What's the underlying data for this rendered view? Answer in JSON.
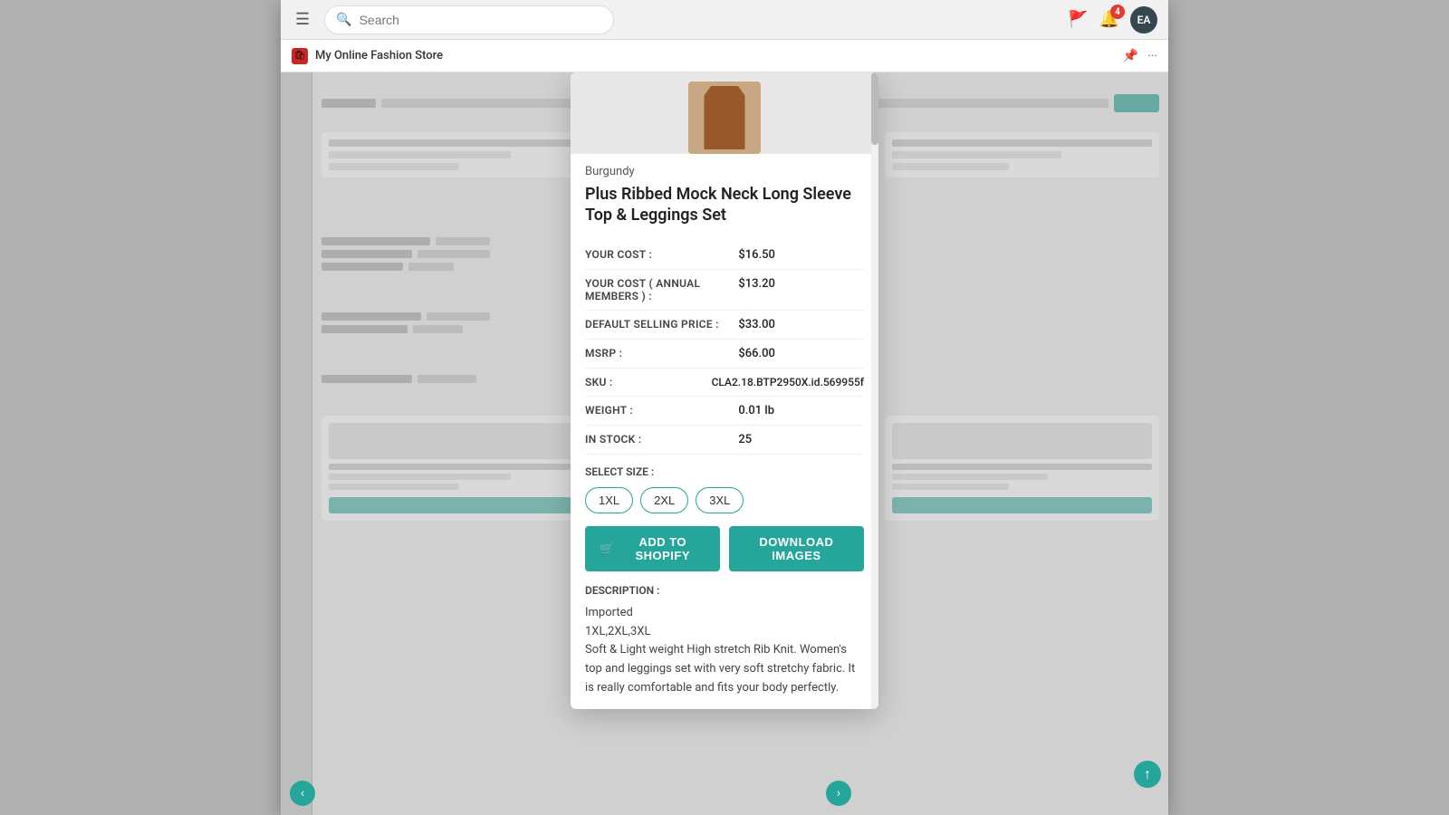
{
  "browser": {
    "search_placeholder": "Search",
    "notification_count": "4",
    "avatar_initials": "EA",
    "store_name": "My Online Fashion Store",
    "pin_icon": "📌",
    "more_icon": "···"
  },
  "product": {
    "color": "Burgundy",
    "title": "Plus Ribbed Mock Neck Long Sleeve Top & Leggings Set",
    "your_cost_label": "YOUR COST :",
    "your_cost_value": "$16.50",
    "your_cost_annual_label": "YOUR COST ( ANNUAL MEMBERS ) :",
    "your_cost_annual_value": "$13.20",
    "default_selling_label": "DEFAULT SELLING PRICE :",
    "default_selling_value": "$33.00",
    "msrp_label": "MSRP :",
    "msrp_value": "$66.00",
    "sku_label": "SKU :",
    "sku_value": "CLA2.18.BTP2950X.id.569955f",
    "weight_label": "WEIGHT :",
    "weight_value": "0.01 lb",
    "in_stock_label": "IN STOCK :",
    "in_stock_value": "25",
    "select_size_label": "SELECT SIZE :",
    "sizes": [
      "1XL",
      "2XL",
      "3XL"
    ],
    "add_to_shopify_label": "ADD TO SHOPIFY",
    "download_images_label": "DOWNLOAD IMAGES",
    "description_label": "DESCRIPTION :",
    "description_lines": [
      "Imported",
      "1XL,2XL,3XL",
      "Soft & Light weight High stretch Rib Knit. Women's top and leggings set with very soft stretchy fabric. It is really comfortable and fits your body perfectly."
    ]
  }
}
